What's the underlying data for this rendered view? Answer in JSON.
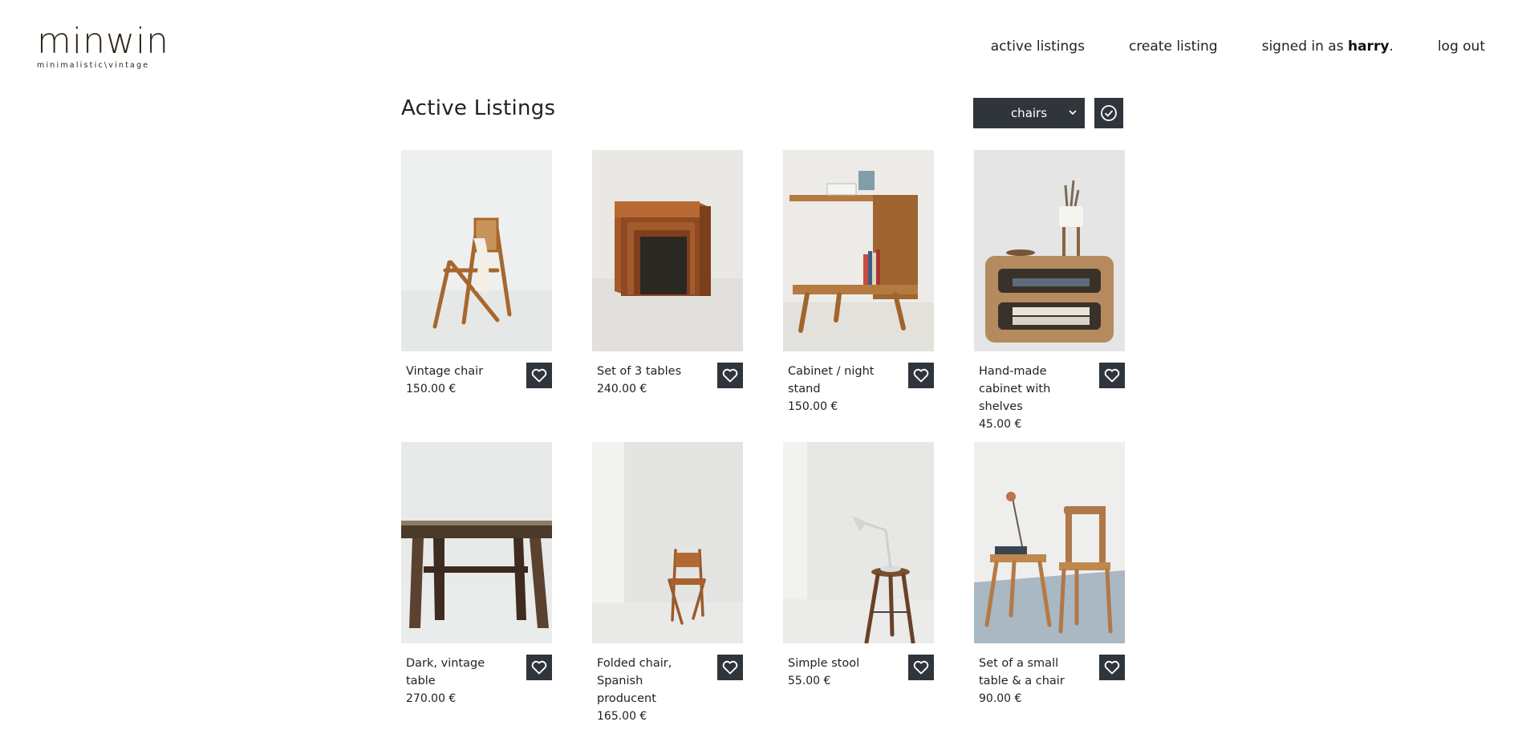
{
  "brand": {
    "name": "minwin",
    "tagline": "minimalistic\\vintage"
  },
  "nav": {
    "active_listings": "active listings",
    "create_listing": "create listing",
    "signed_in_prefix": "signed in as ",
    "username": "harry",
    "signed_in_suffix": ".",
    "log_out": "log out"
  },
  "page": {
    "title": "Active Listings"
  },
  "filter": {
    "selected": "chairs"
  },
  "listings": [
    {
      "title": "Vintage chair",
      "price": "150.00 €"
    },
    {
      "title": "Set of 3 tables",
      "price": "240.00 €"
    },
    {
      "title": "Cabinet / night stand",
      "price": "150.00 €"
    },
    {
      "title": "Hand-made cabinet with shelves",
      "price": "45.00 €"
    },
    {
      "title": "Dark, vintage table",
      "price": "270.00 €"
    },
    {
      "title": "Folded chair, Spanish producent",
      "price": "165.00 €"
    },
    {
      "title": "Simple stool",
      "price": "55.00 €"
    },
    {
      "title": "Set of a small table & a chair",
      "price": "90.00 €"
    }
  ],
  "colors": {
    "accent": "#2f353b",
    "logo": "#2e2419"
  },
  "icons": {
    "favorite": "heart-icon",
    "apply": "check-circle-icon",
    "dropdown": "chevron-down-icon"
  }
}
